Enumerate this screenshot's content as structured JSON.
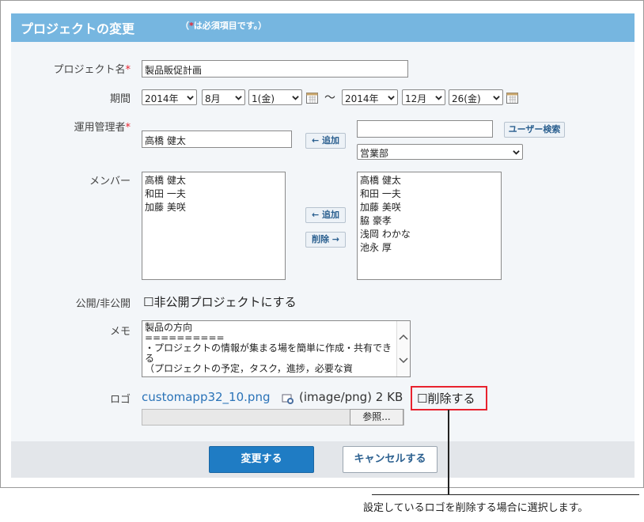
{
  "header": {
    "title": "プロジェクトの変更",
    "note_prefix": "（",
    "note_star": "*",
    "note_suffix": "は必須項目です。）"
  },
  "fields": {
    "project_name": {
      "label": "プロジェクト名",
      "required": "*",
      "value": "製品販促計画"
    },
    "period": {
      "label": "期間",
      "start": {
        "year": "2014年",
        "month": "8月",
        "day": "1(金)"
      },
      "separator": "〜",
      "end": {
        "year": "2014年",
        "month": "12月",
        "day": "26(金)"
      }
    },
    "manager": {
      "label": "運用管理者",
      "required": "*",
      "value": "高橋 健太",
      "add_button": "← 追加",
      "search_value": "",
      "user_search_button": "ユーザー検索",
      "department": "営業部"
    },
    "members": {
      "label": "メンバー",
      "current": [
        "高橋 健太",
        "和田 一夫",
        "加藤 美咲"
      ],
      "add_button": "← 追加",
      "remove_button": "削除 →",
      "candidates": [
        "高橋 健太",
        "和田 一夫",
        "加藤 美咲",
        "脇 豪孝",
        "浅岡 わかな",
        "池永 厚"
      ]
    },
    "visibility": {
      "label": "公開/非公開",
      "checkbox": "☐",
      "text": "非公開プロジェクトにする"
    },
    "memo": {
      "label": "メモ",
      "value": "製品の方向\n==========\n・プロジェクトの情報が集まる場を簡単に作成・共有できる\n（プロジェクトの予定，タスク，進捗，必要な資"
    },
    "logo": {
      "label": "ロゴ",
      "file_name": "customapp32_10.png",
      "file_info": "(image/png) 2 KB",
      "delete_checkbox": "☐",
      "delete_text": "削除する",
      "browse_button": "参照..."
    }
  },
  "footer": {
    "submit": "変更する",
    "cancel": "キャンセルする"
  },
  "callout": "設定しているロゴを削除する場合に選択します。"
}
